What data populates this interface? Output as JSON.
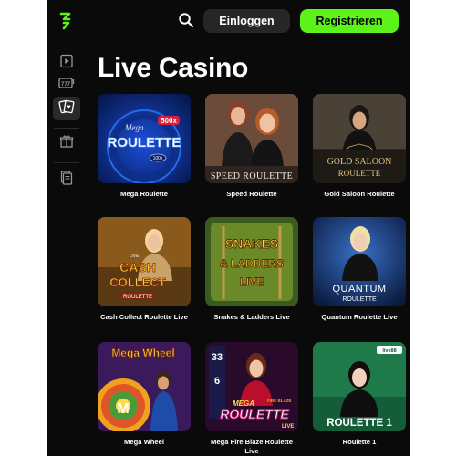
{
  "header": {
    "login_label": "Einloggen",
    "register_label": "Registrieren",
    "colors": {
      "accent": "#5bf31a",
      "background": "#0a0a0a",
      "button_dark": "#262626"
    }
  },
  "sidebar": {
    "items": [
      {
        "icon": "play-video-icon"
      },
      {
        "icon": "slot-machine-icon"
      },
      {
        "icon": "playing-cards-icon",
        "active": true
      },
      {
        "icon": "gift-icon"
      },
      {
        "icon": "document-list-icon"
      }
    ]
  },
  "page": {
    "title": "Live Casino"
  },
  "games": [
    {
      "name": "Mega Roulette",
      "art_title": "ROULETTE",
      "art_sub": "Mega",
      "badge": "500x",
      "chip": "100x"
    },
    {
      "name": "Speed Roulette",
      "art_title": "SPEED ROULETTE"
    },
    {
      "name": "Gold Saloon Roulette",
      "art_title": "GOLD SALOON",
      "art_sub": "ROULETTE"
    },
    {
      "name": "Cash Collect Roulette Live",
      "art_title": "CASH",
      "art_sub": "COLLECT",
      "art_sub2": "ROULETTE",
      "art_top": "LIVE"
    },
    {
      "name": "Snakes & Ladders Live",
      "art_title": "SNAKES",
      "art_sub": "& LADDERS",
      "art_sub2": "LIVE"
    },
    {
      "name": "Quantum Roulette Live",
      "art_title": "QUANTUM",
      "art_sub": "ROULETTE"
    },
    {
      "name": "Mega Wheel",
      "art_title": "Mega Wheel",
      "art_sub": "M"
    },
    {
      "name": "Mega Fire Blaze Roulette Live",
      "art_title": "ROULETTE",
      "art_sub": "MEGA",
      "art_sub2": "FIRE BLAZE",
      "badge": "33",
      "chip": "6",
      "art_top": "LIVE"
    },
    {
      "name": "Roulette 1",
      "art_title": "ROULETTE 1",
      "badge": "live88"
    }
  ]
}
